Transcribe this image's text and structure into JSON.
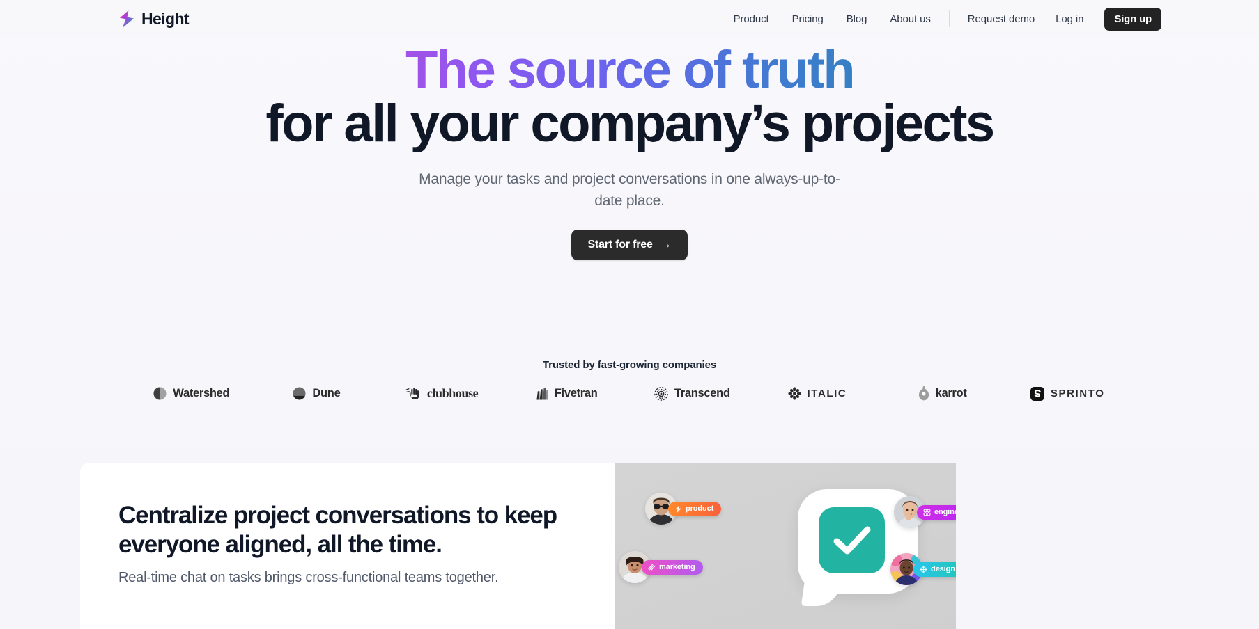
{
  "brand": {
    "name": "Height",
    "logo_icon": "lightning-bolt-icon",
    "gradient_start": "#f5289a",
    "gradient_mid": "#8d58f0",
    "gradient_end": "#1bb79a"
  },
  "nav": {
    "links": [
      {
        "label": "Product"
      },
      {
        "label": "Pricing"
      },
      {
        "label": "Blog"
      },
      {
        "label": "About us"
      }
    ],
    "request_demo": "Request demo",
    "log_in": "Log in",
    "sign_up": "Sign up"
  },
  "hero": {
    "headline_line1": "The source of truth",
    "headline_line2": "for all your company’s projects",
    "subheadline": "Manage your tasks and project conversations in one always-up-to-date place.",
    "cta_label": "Start for free",
    "cta_icon": "arrow-right-icon"
  },
  "trusted": {
    "title": "Trusted by fast-growing companies",
    "logos": [
      {
        "name": "Watershed",
        "icon": "split-circle-icon"
      },
      {
        "name": "Dune",
        "icon": "half-filled-circle-icon"
      },
      {
        "name": "clubhouse",
        "icon": "waving-hand-icon"
      },
      {
        "name": "Fivetran",
        "icon": "slanted-bars-icon"
      },
      {
        "name": "Transcend",
        "icon": "concentric-rings-icon"
      },
      {
        "name": "ITALIC",
        "icon": "floral-asterisk-icon"
      },
      {
        "name": "karrot",
        "icon": "balloon-icon"
      },
      {
        "name": "SPRINTO",
        "icon": "rounded-square-s-icon"
      }
    ]
  },
  "feature": {
    "heading": "Centralize project conversations to keep everyone aligned, all the time.",
    "body": "Real-time chat on tasks brings cross-functional teams together.",
    "illustration": {
      "bubble_icon": "checkmark-icon",
      "bubble_color": "#22b3a2",
      "tags": [
        {
          "label": "product",
          "icon": "lightning-bolt-icon",
          "color": "#fb5f3b"
        },
        {
          "label": "marketing",
          "icon": "waves-icon",
          "color": "#ee4fc4"
        },
        {
          "label": "engineering",
          "icon": "four-dots-icon",
          "color": "#cf2ee8"
        },
        {
          "label": "design",
          "icon": "snowflake-icon",
          "color": "#22c5b4"
        }
      ]
    }
  }
}
